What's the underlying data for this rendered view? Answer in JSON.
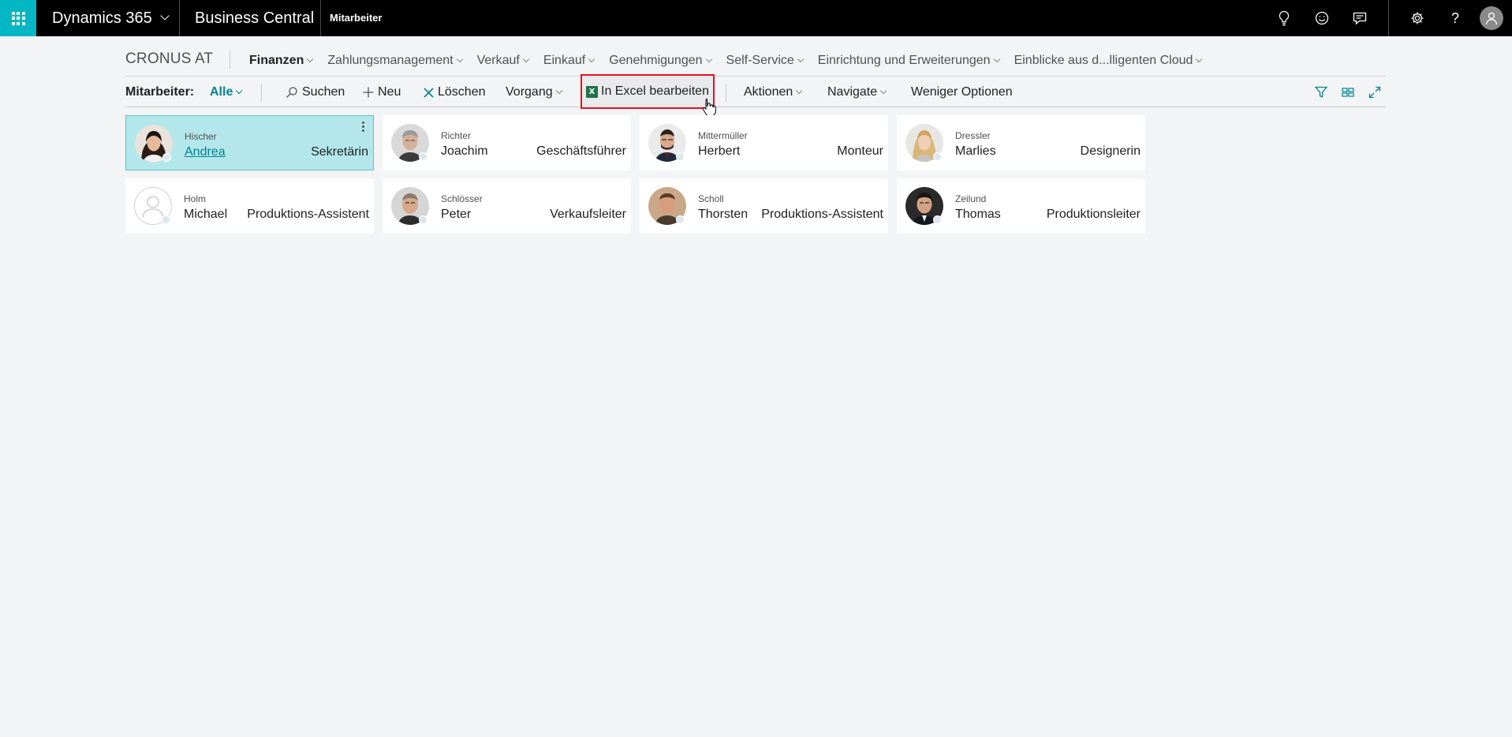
{
  "topbar": {
    "product": "Dynamics 365",
    "app": "Business Central",
    "page": "Mitarbeiter",
    "icons": [
      "lightbulb-icon",
      "smiley-icon",
      "chat-icon",
      "gear-icon",
      "help-icon",
      "user-icon"
    ],
    "help_label": "?"
  },
  "nav": {
    "company": "CRONUS AT",
    "items": [
      {
        "label": "Finanzen"
      },
      {
        "label": "Zahlungsmanagement"
      },
      {
        "label": "Verkauf"
      },
      {
        "label": "Einkauf"
      },
      {
        "label": "Genehmigungen"
      },
      {
        "label": "Self-Service"
      },
      {
        "label": "Einrichtung und Erweiterungen"
      },
      {
        "label": "Einblicke aus d...lligenten Cloud"
      }
    ]
  },
  "actionbar": {
    "title": "Mitarbeiter:",
    "filter": "Alle",
    "search": "Suchen",
    "new": "Neu",
    "delete": "Löschen",
    "process": "Vorgang",
    "excel": "In Excel bearbeiten",
    "actions": "Aktionen",
    "navigate": "Navigate",
    "fewer": "Weniger Optionen"
  },
  "employees": [
    {
      "last": "Hischer",
      "first": "Andrea",
      "title": "Sekretärin"
    },
    {
      "last": "Richter",
      "first": "Joachim",
      "title": "Geschäftsführer"
    },
    {
      "last": "Mittermüller",
      "first": "Herbert",
      "title": "Monteur"
    },
    {
      "last": "Dressler",
      "first": "Marlies",
      "title": "Designerin"
    },
    {
      "last": "Holm",
      "first": "Michael",
      "title": "Produktions-Assistent"
    },
    {
      "last": "Schlösser",
      "first": "Peter",
      "title": "Verkaufsleiter"
    },
    {
      "last": "Scholl",
      "first": "Thorsten",
      "title": "Produktions-Assistent"
    },
    {
      "last": "Zeilund",
      "first": "Thomas",
      "title": "Produktionsleiter"
    }
  ],
  "colors": {
    "accent": "#00b7c3",
    "link": "#00838f",
    "selected_card": "#b3e7ec",
    "highlight_border": "#e81123"
  }
}
